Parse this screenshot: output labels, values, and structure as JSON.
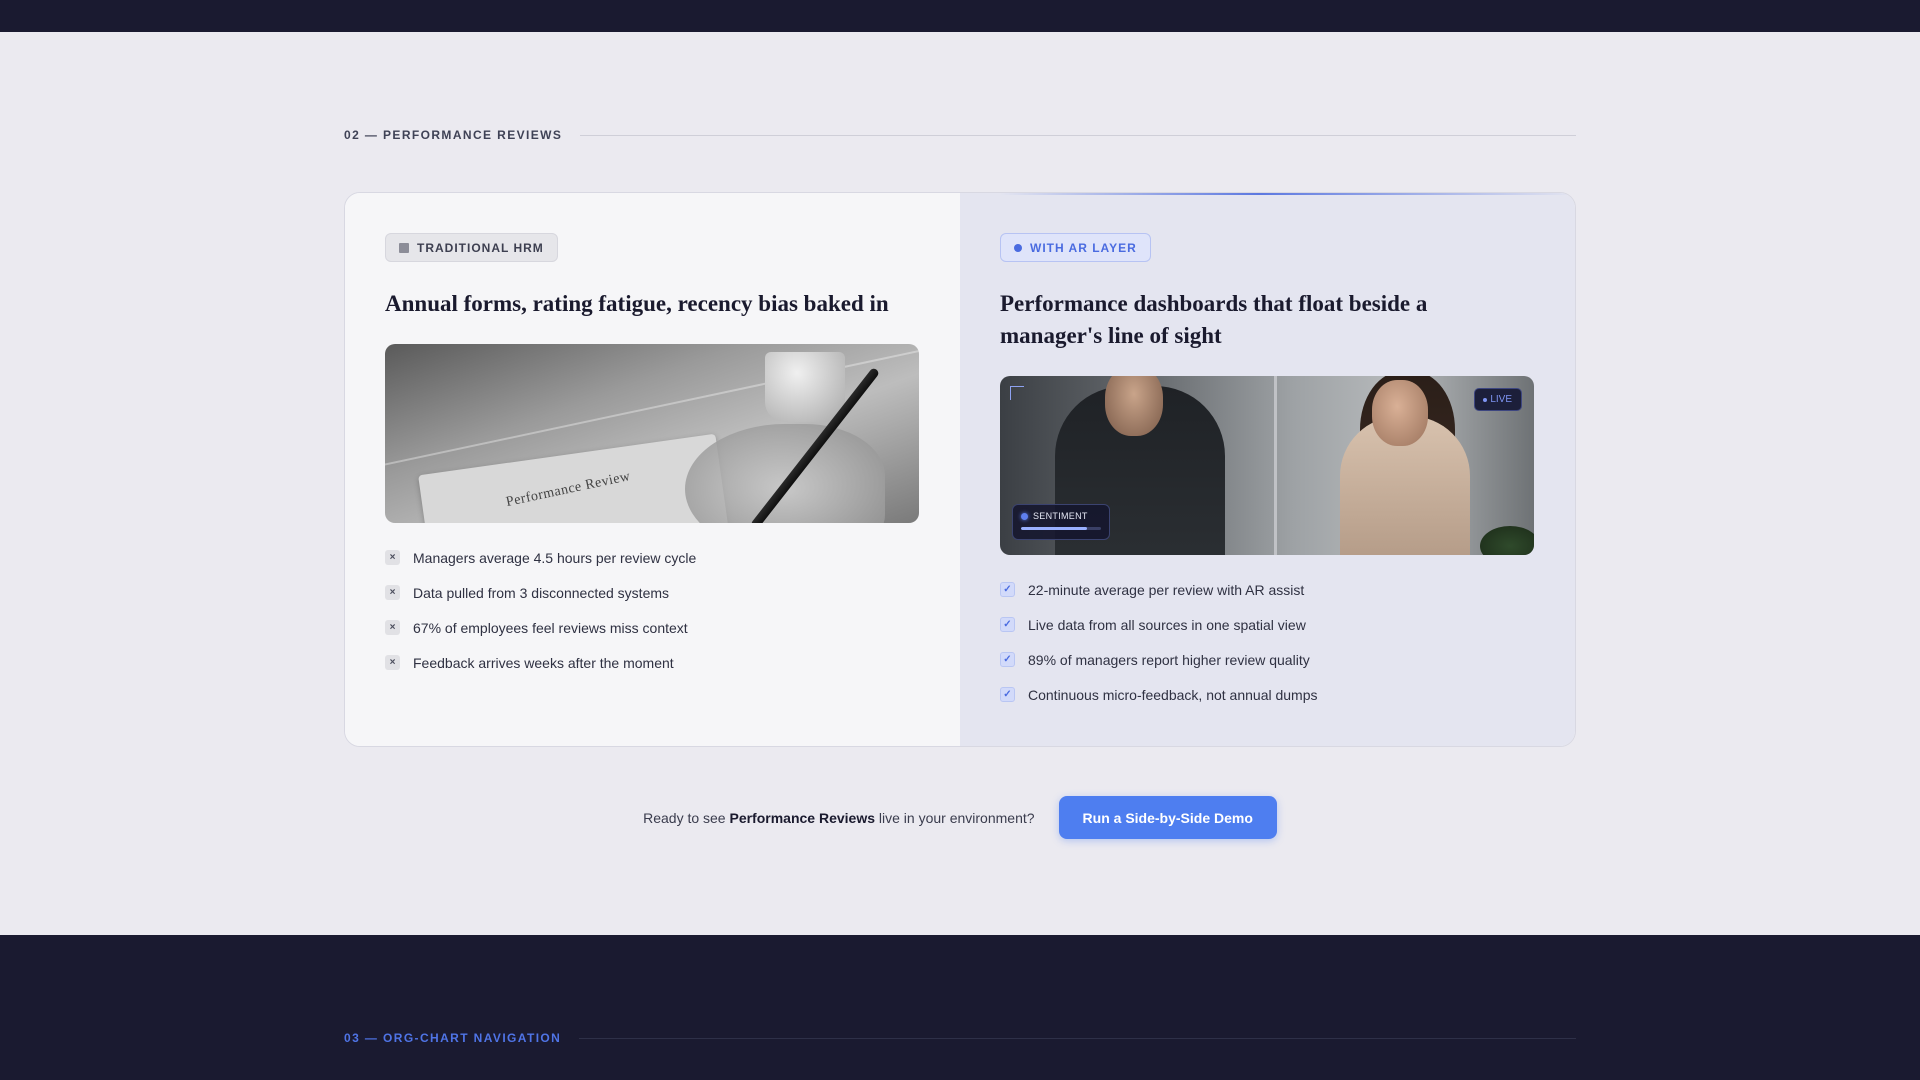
{
  "section": {
    "label": "02 — PERFORMANCE REVIEWS"
  },
  "traditional": {
    "tag": "TRADITIONAL HRM",
    "heading": "Annual forms, rating fatigue, recency bias baked in",
    "photo_text": "Performance Review",
    "items": [
      "Managers average 4.5 hours per review cycle",
      "Data pulled from 3 disconnected systems",
      "67% of employees feel reviews miss context",
      "Feedback arrives weeks after the moment"
    ],
    "item_mark": "×"
  },
  "ar_layer": {
    "tag": "WITH AR LAYER",
    "heading": "Performance dashboards that float beside a manager's line of sight",
    "live_badge": "LIVE",
    "sentiment_label": "SENTIMENT",
    "sentiment_level": 0.82,
    "items": [
      "22-minute average per review with AR assist",
      "Live data from all sources in one spatial view",
      "89% of managers report higher review quality",
      "Continuous micro-feedback, not annual dumps"
    ],
    "item_mark": "✓"
  },
  "cta": {
    "prefix": "Ready to see ",
    "highlight": "Performance Reviews",
    "suffix": " live in your environment?",
    "button": "Run a Side-by-Side Demo"
  },
  "next_section": {
    "label": "03 — ORG-CHART NAVIGATION"
  },
  "colors": {
    "accent": "#4e7ef0",
    "dark_bg": "#1a1a30",
    "page_bg": "#ebeaf0"
  },
  "icons": {
    "trad_tag": "square-icon",
    "ar_tag": "dot-icon",
    "trad_item": "x-mark-icon",
    "ar_item": "checkmark-icon"
  }
}
